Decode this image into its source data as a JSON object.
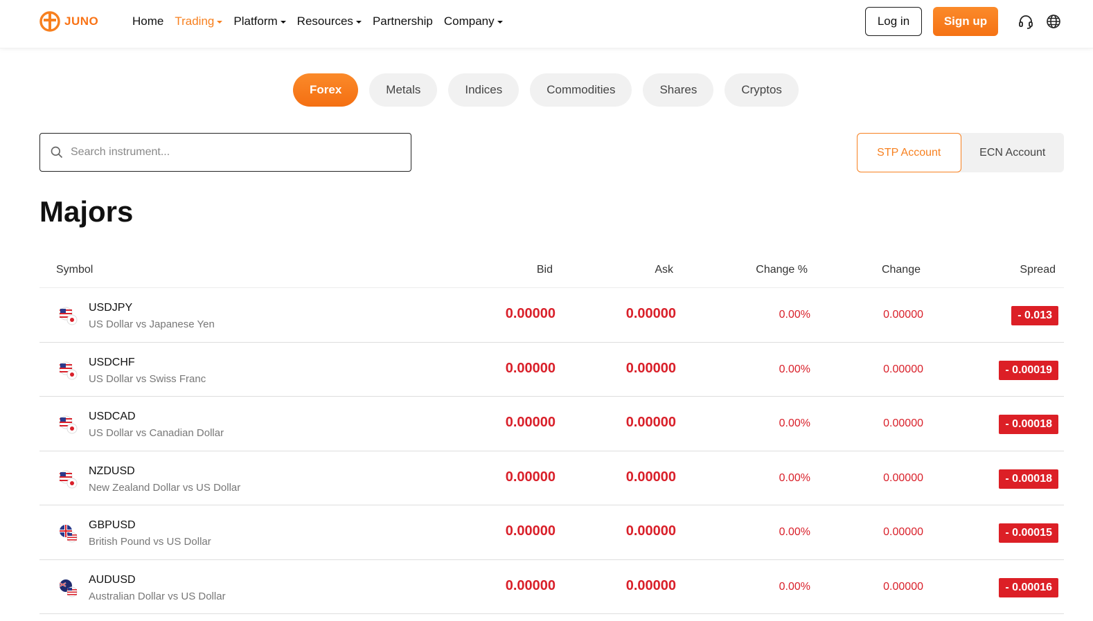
{
  "brand": {
    "name": "JUNO",
    "accent": "#f7801f"
  },
  "nav": [
    {
      "label": "Home",
      "dropdown": false,
      "active": false
    },
    {
      "label": "Trading",
      "dropdown": true,
      "active": true
    },
    {
      "label": "Platform",
      "dropdown": true,
      "active": false
    },
    {
      "label": "Resources",
      "dropdown": true,
      "active": false
    },
    {
      "label": "Partnership",
      "dropdown": false,
      "active": false
    },
    {
      "label": "Company",
      "dropdown": true,
      "active": false
    }
  ],
  "header": {
    "login_label": "Log in",
    "signup_label": "Sign up",
    "support_icon": "headset-icon",
    "language_icon": "globe-icon"
  },
  "categories": [
    {
      "label": "Forex",
      "active": true
    },
    {
      "label": "Metals",
      "active": false
    },
    {
      "label": "Indices",
      "active": false
    },
    {
      "label": "Commodities",
      "active": false
    },
    {
      "label": "Shares",
      "active": false
    },
    {
      "label": "Cryptos",
      "active": false
    }
  ],
  "search": {
    "placeholder": "Search instrument...",
    "value": ""
  },
  "accounts": [
    {
      "label": "STP Account",
      "active": true
    },
    {
      "label": "ECN Account",
      "active": false
    }
  ],
  "section_title": "Majors",
  "table": {
    "columns": {
      "symbol": "Symbol",
      "bid": "Bid",
      "ask": "Ask",
      "change_pct": "Change %",
      "change": "Change",
      "spread": "Spread"
    },
    "rows": [
      {
        "symbol": "USDJPY",
        "name": "US Dollar vs Japanese Yen",
        "bid": "0.00000",
        "ask": "0.00000",
        "change_pct": "0.00%",
        "change": "0.00000",
        "spread": "- 0.013",
        "flag": "usd-jpy"
      },
      {
        "symbol": "USDCHF",
        "name": "US Dollar vs Swiss Franc",
        "bid": "0.00000",
        "ask": "0.00000",
        "change_pct": "0.00%",
        "change": "0.00000",
        "spread": "- 0.00019",
        "flag": "usd-chf"
      },
      {
        "symbol": "USDCAD",
        "name": "US Dollar vs Canadian Dollar",
        "bid": "0.00000",
        "ask": "0.00000",
        "change_pct": "0.00%",
        "change": "0.00000",
        "spread": "- 0.00018",
        "flag": "usd-cad"
      },
      {
        "symbol": "NZDUSD",
        "name": "New Zealand Dollar vs US Dollar",
        "bid": "0.00000",
        "ask": "0.00000",
        "change_pct": "0.00%",
        "change": "0.00000",
        "spread": "- 0.00018",
        "flag": "nzd-usd"
      },
      {
        "symbol": "GBPUSD",
        "name": "British Pound vs US Dollar",
        "bid": "0.00000",
        "ask": "0.00000",
        "change_pct": "0.00%",
        "change": "0.00000",
        "spread": "- 0.00015",
        "flag": "gbp-usd"
      },
      {
        "symbol": "AUDUSD",
        "name": "Australian Dollar vs US Dollar",
        "bid": "0.00000",
        "ask": "0.00000",
        "change_pct": "0.00%",
        "change": "0.00000",
        "spread": "- 0.00016",
        "flag": "aud-usd"
      }
    ]
  }
}
